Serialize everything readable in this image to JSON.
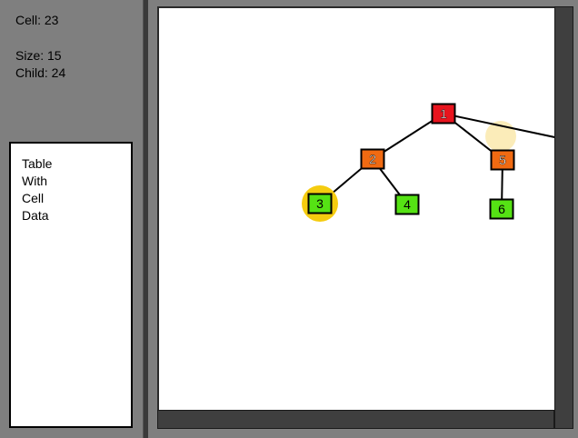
{
  "info": {
    "cell": "Cell: 23",
    "size": "Size: 15",
    "child": "Child: 24"
  },
  "info_box": {
    "lines": [
      "Table",
      "With",
      "Cell",
      "Data"
    ]
  },
  "tree": {
    "nodes": [
      {
        "id": "1",
        "label": "1",
        "color": "#e8141e"
      },
      {
        "id": "2",
        "label": "2",
        "color": "#f06a12"
      },
      {
        "id": "3",
        "label": "3",
        "color": "#55e214",
        "highlighted": true
      },
      {
        "id": "4",
        "label": "4",
        "color": "#55e214"
      },
      {
        "id": "5",
        "label": "5",
        "color": "#f06a12"
      },
      {
        "id": "6",
        "label": "6",
        "color": "#55e214"
      }
    ],
    "edges": [
      [
        "1",
        "2"
      ],
      [
        "1",
        "5"
      ],
      [
        "2",
        "3"
      ],
      [
        "2",
        "4"
      ],
      [
        "5",
        "6"
      ]
    ],
    "highlight_color": "#f5cc0f",
    "hover_color": "#fbecb9"
  }
}
